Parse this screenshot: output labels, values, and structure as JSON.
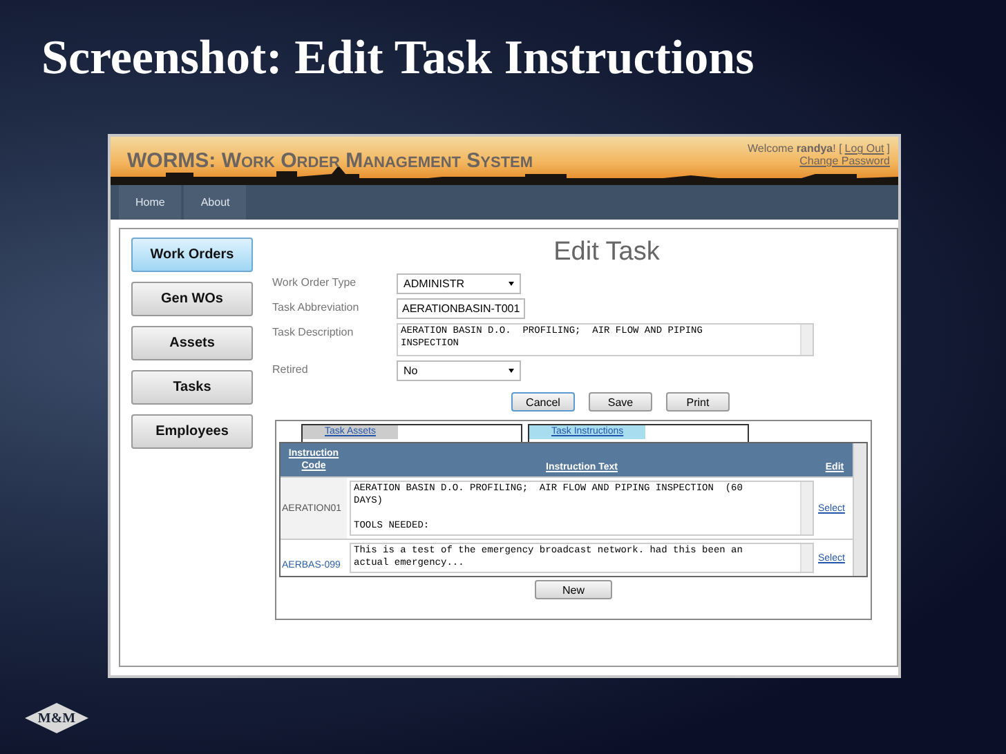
{
  "slide_title": "Screenshot: Edit Task Instructions",
  "app": {
    "title": "WORMS: Work Order Management System",
    "welcome": "Welcome **randya**! [",
    "logout": "Log Out",
    "bracket_close": "]",
    "change_password": "Change Password"
  },
  "nav": [
    "Home",
    "About"
  ],
  "sidebar": [
    {
      "label": "Work Orders",
      "selected": true
    },
    {
      "label": "Gen WOs",
      "selected": false
    },
    {
      "label": "Assets",
      "selected": false
    },
    {
      "label": "Tasks",
      "selected": false
    },
    {
      "label": "Employees",
      "selected": false
    }
  ],
  "page_title": "Edit Task",
  "fields": [
    {
      "label": "Work Order Type",
      "kind": "select",
      "value": "ADMINISTR"
    },
    {
      "label": "Task Abbreviation",
      "kind": "input",
      "value": "AERATIONBASIN-T001"
    },
    {
      "label": "Task Description",
      "kind": "textarea",
      "value": "AERATION BASIN D.O.  PROFILING;  AIR FLOW AND PIPING\nINSPECTION"
    },
    {
      "label": "Retired",
      "kind": "select",
      "value": "No"
    }
  ],
  "buttons": [
    "Cancel",
    "Save",
    "Print"
  ],
  "tabs": [
    {
      "label": "Task Assets",
      "selected": false
    },
    {
      "label": "Task Instructions",
      "selected": true
    }
  ],
  "grid": {
    "columns": [
      "Instruction\nCode",
      "Instruction Text",
      "Edit"
    ],
    "rows": [
      {
        "code": "AERATION01",
        "link": false,
        "text": "AERATION BASIN D.O. PROFILING;  AIR FLOW AND PIPING INSPECTION  (60\nDAYS)\n\nTOOLS NEEDED:",
        "action": "Select"
      },
      {
        "code": "AERBAS-099",
        "link": true,
        "text": "This is a test of the emergency broadcast network. had this been an\nactual emergency...",
        "action": "Select"
      }
    ],
    "new_button": "New"
  },
  "logo": "M&M"
}
